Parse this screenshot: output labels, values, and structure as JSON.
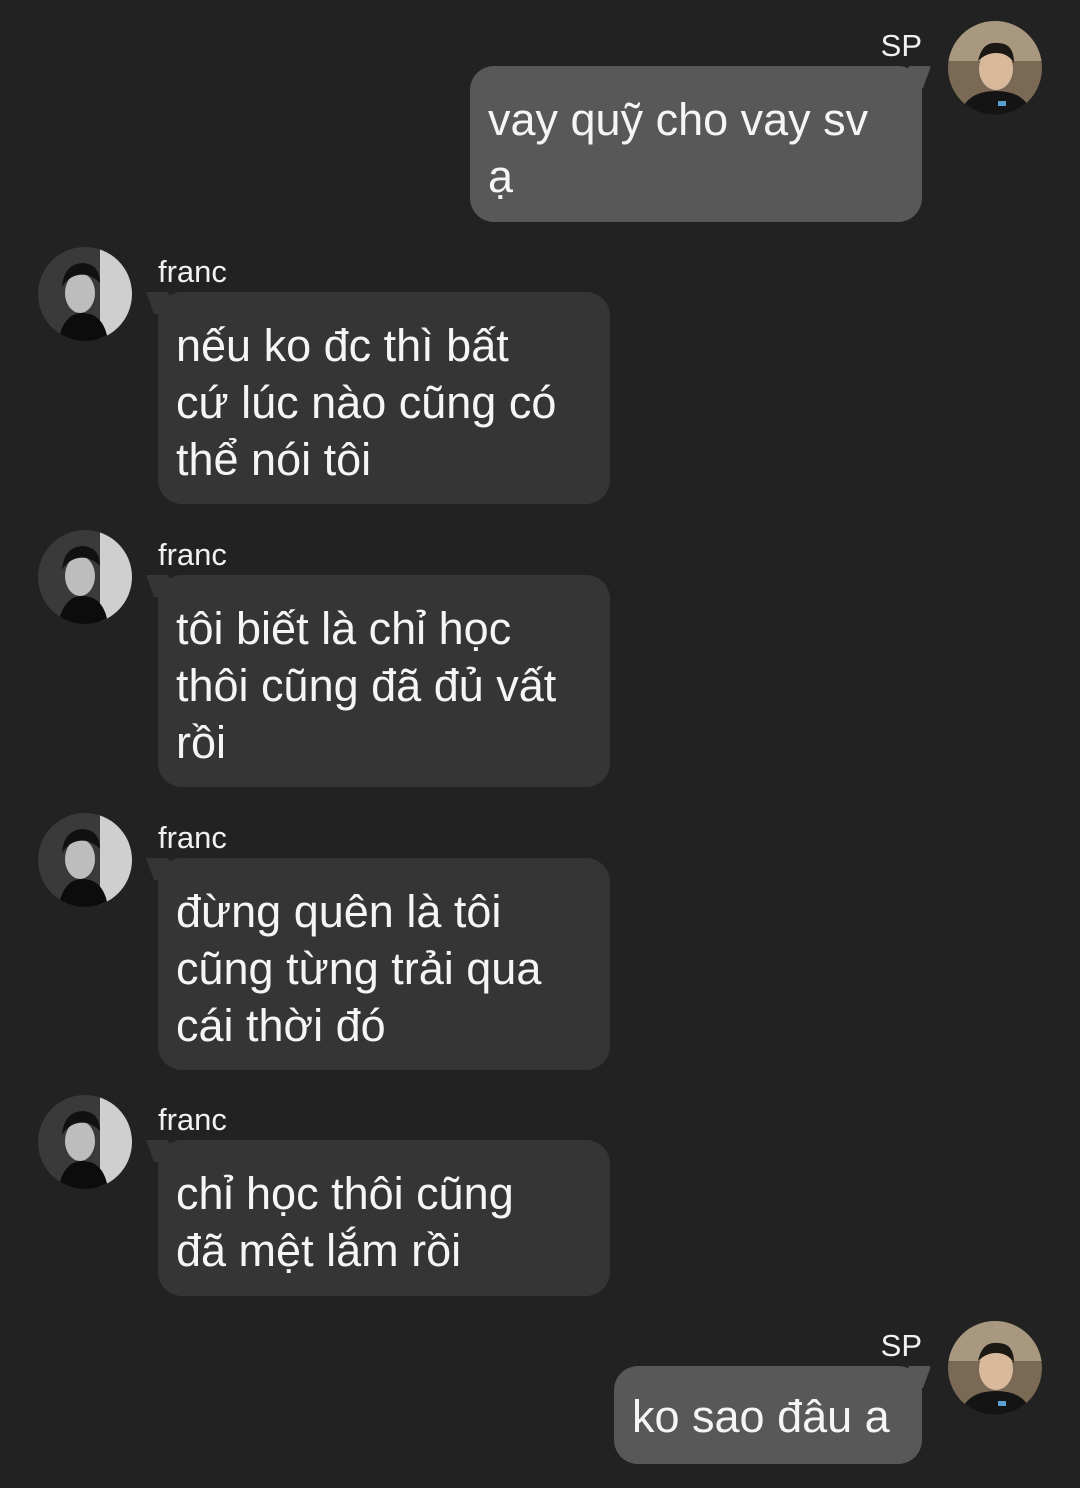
{
  "colors": {
    "background": "#222222",
    "outgoing_bubble": "#585858",
    "incoming_bubble": "#353535",
    "text": "#f5f5f5"
  },
  "messages": [
    {
      "direction": "outgoing",
      "sender": "SP",
      "avatar_icon": "user-avatar-icon",
      "text": "vay quỹ cho vay sv\nạ"
    },
    {
      "direction": "incoming",
      "sender": "franc",
      "avatar_icon": "contact-avatar-icon",
      "text": "nếu ko đc thì bất\ncứ lúc nào cũng có\nthể nói tôi"
    },
    {
      "direction": "incoming",
      "sender": "franc",
      "avatar_icon": "contact-avatar-icon",
      "text": "tôi biết là chỉ học\nthôi cũng đã đủ vất\nrồi"
    },
    {
      "direction": "incoming",
      "sender": "franc",
      "avatar_icon": "contact-avatar-icon",
      "text": "đừng quên là tôi\ncũng từng trải qua\ncái thời đó"
    },
    {
      "direction": "incoming",
      "sender": "franc",
      "avatar_icon": "contact-avatar-icon",
      "text": "chỉ học thôi cũng\nđã mệt lắm rồi"
    },
    {
      "direction": "outgoing",
      "sender": "SP",
      "avatar_icon": "user-avatar-icon",
      "text": "ko sao đâu a"
    }
  ]
}
